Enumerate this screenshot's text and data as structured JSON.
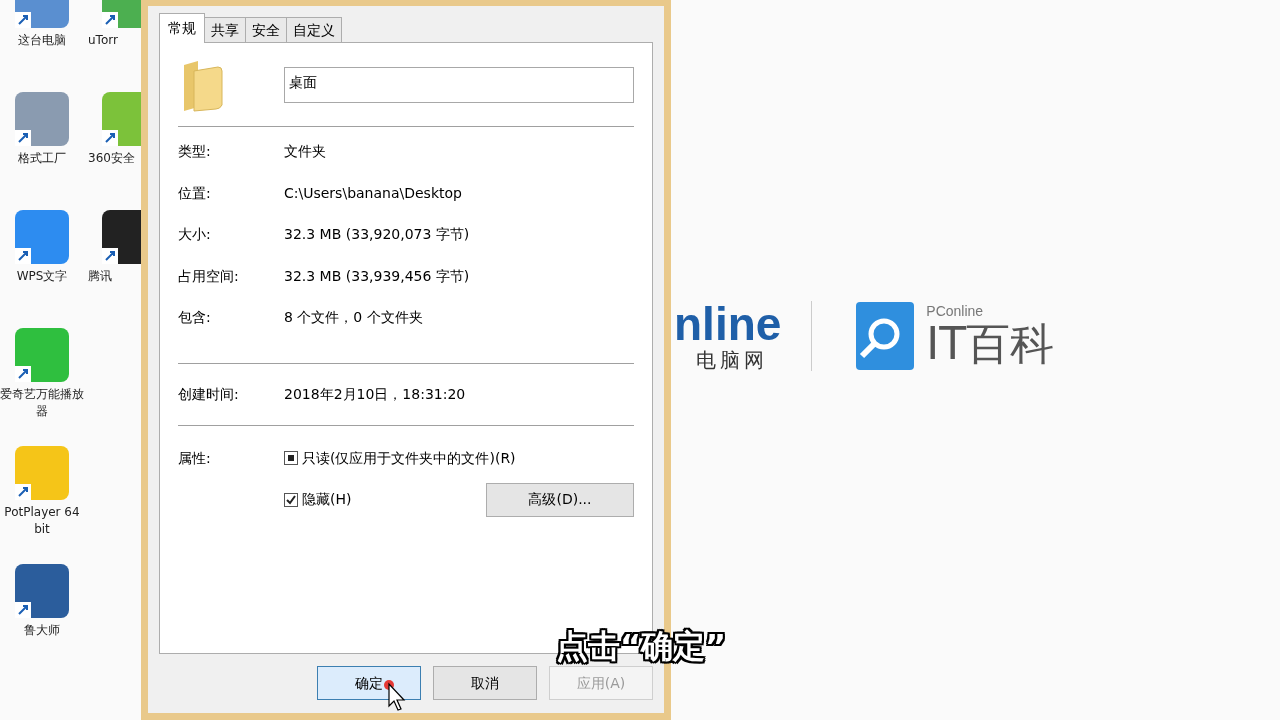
{
  "desktop": {
    "column_1": [
      {
        "label": "这台电脑",
        "kind": "computer"
      },
      {
        "label": "格式工厂",
        "kind": "factory"
      },
      {
        "label": "WPS文字",
        "kind": "wps"
      },
      {
        "label": "爱奇艺万能播放器",
        "kind": "iqiyi"
      },
      {
        "label": "PotPlayer 64 bit",
        "kind": "potplayer"
      },
      {
        "label": "鲁大师",
        "kind": "ludashi"
      }
    ],
    "column_2": [
      {
        "label": "uTorr",
        "kind": "utorrent"
      },
      {
        "label": "360安全",
        "kind": "security"
      },
      {
        "label": "腾讯",
        "kind": "qq"
      }
    ]
  },
  "wallpaper": {
    "brand": "nline",
    "brand_sub": "电脑网",
    "logo_small": "PConline",
    "logo_text": "IT百科"
  },
  "dialog": {
    "tabs": [
      {
        "label": "常规",
        "selected": true
      },
      {
        "label": "共享",
        "selected": false
      },
      {
        "label": "安全",
        "selected": false
      },
      {
        "label": "自定义",
        "selected": false
      }
    ],
    "name_value": "桌面",
    "details": [
      {
        "label": "类型:",
        "value": "文件夹"
      },
      {
        "label": "位置:",
        "value": "C:\\Users\\banana\\Desktop"
      },
      {
        "label": "大小:",
        "value": "32.3 MB (33,920,073 字节)"
      },
      {
        "label": "占用空间:",
        "value": "32.3 MB (33,939,456 字节)"
      },
      {
        "label": "包含:",
        "value": "8 个文件，0 个文件夹"
      }
    ],
    "created": {
      "label": "创建时间:",
      "value": "2018年2月10日，18:31:20"
    },
    "attributes_label": "属性:",
    "attributes": [
      {
        "label": "只读(仅应用于文件夹中的文件)(R)",
        "checked": true,
        "mixed": true
      },
      {
        "label": "隐藏(H)",
        "checked": true,
        "mixed": false
      }
    ],
    "advanced_button": "高级(D)...",
    "buttons": [
      {
        "label": "确定",
        "selected": true,
        "disabled": false
      },
      {
        "label": "取消",
        "selected": false,
        "disabled": false
      },
      {
        "label": "应用(A)",
        "selected": false,
        "disabled": true
      }
    ]
  },
  "caption": "点击“确定”"
}
